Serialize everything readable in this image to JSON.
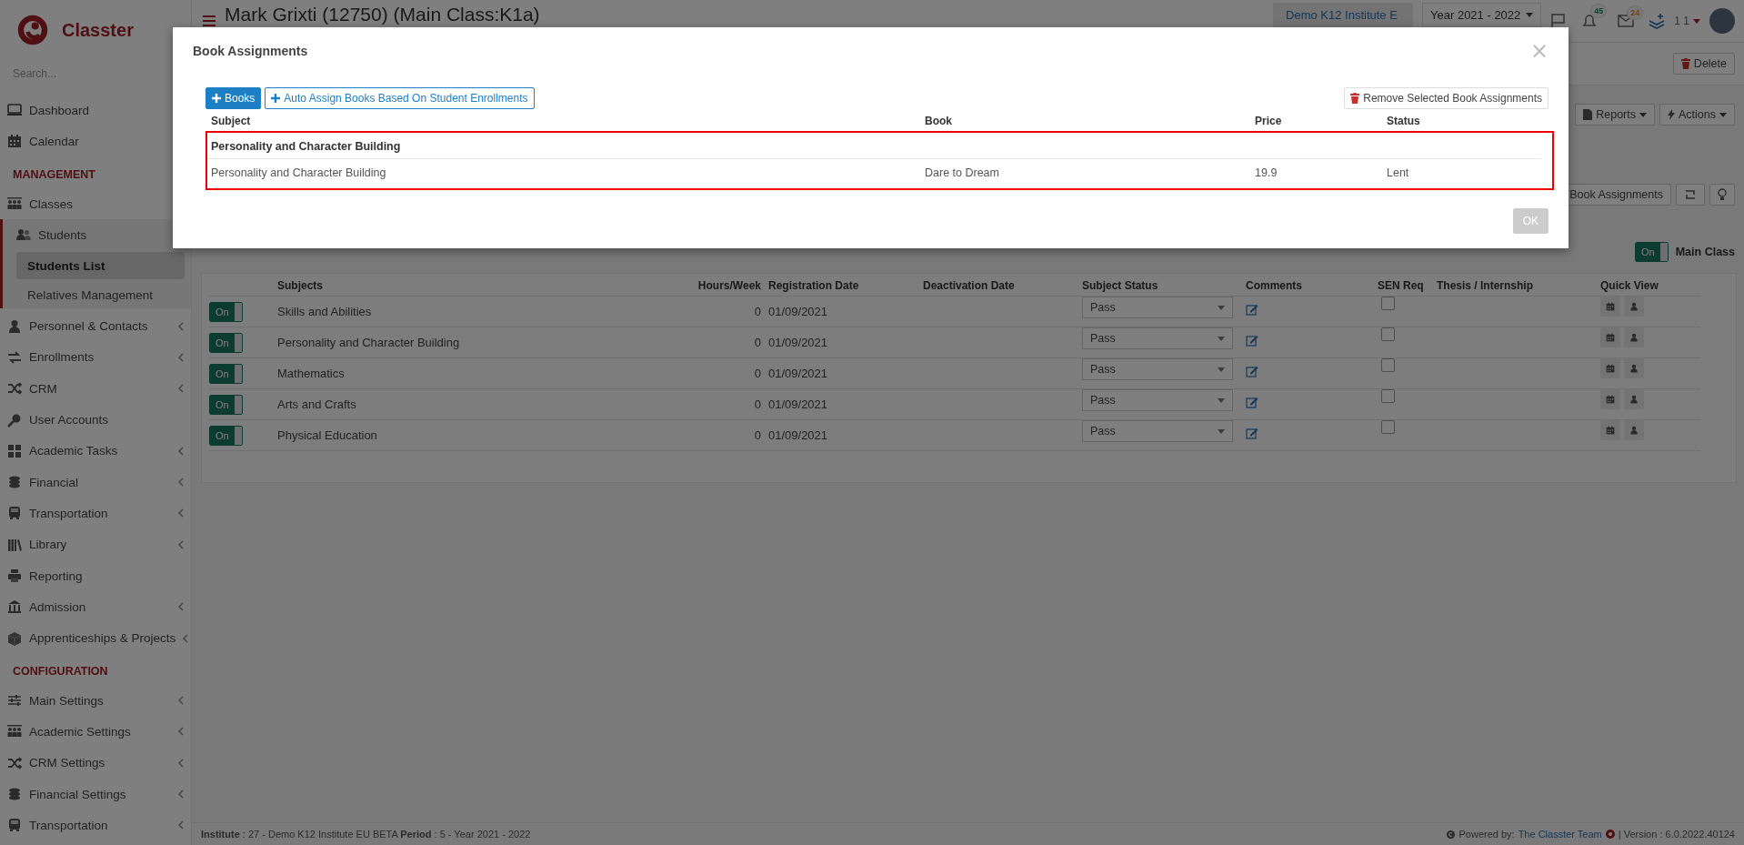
{
  "brand": {
    "name": "Classter"
  },
  "sidebar": {
    "search_placeholder": "Search...",
    "items": [
      {
        "kind": "item",
        "label": "Dashboard",
        "selected": false,
        "submenu": false
      },
      {
        "kind": "item",
        "label": "Calendar",
        "selected": false,
        "submenu": false
      },
      {
        "kind": "heading",
        "label": "MANAGEMENT"
      },
      {
        "kind": "item",
        "label": "Classes",
        "selected": false,
        "submenu": false
      },
      {
        "kind": "item",
        "label": "Students",
        "selected": false,
        "submenu": false,
        "expanded": true,
        "children": [
          {
            "kind": "subitem",
            "label": "Students List",
            "selected": true
          },
          {
            "kind": "subitem",
            "label": "Relatives Management",
            "selected": false
          }
        ]
      },
      {
        "kind": "item",
        "label": "Personnel & Contacts",
        "selected": false,
        "submenu": true
      },
      {
        "kind": "item",
        "label": "Enrollments",
        "selected": false,
        "submenu": true
      },
      {
        "kind": "item",
        "label": "CRM",
        "selected": false,
        "submenu": true
      },
      {
        "kind": "item",
        "label": "User Accounts",
        "selected": false,
        "submenu": false
      },
      {
        "kind": "item",
        "label": "Academic Tasks",
        "selected": false,
        "submenu": true
      },
      {
        "kind": "item",
        "label": "Financial",
        "selected": false,
        "submenu": true
      },
      {
        "kind": "item",
        "label": "Transportation",
        "selected": false,
        "submenu": true
      },
      {
        "kind": "item",
        "label": "Library",
        "selected": false,
        "submenu": true
      },
      {
        "kind": "item",
        "label": "Reporting",
        "selected": false,
        "submenu": false
      },
      {
        "kind": "item",
        "label": "Admission",
        "selected": false,
        "submenu": true
      },
      {
        "kind": "item",
        "label": "Apprenticeships & Projects",
        "selected": false,
        "submenu": true
      },
      {
        "kind": "heading",
        "label": "CONFIGURATION"
      },
      {
        "kind": "item",
        "label": "Main Settings",
        "selected": false,
        "submenu": true
      },
      {
        "kind": "item",
        "label": "Academic Settings",
        "selected": false,
        "submenu": true
      },
      {
        "kind": "item",
        "label": "CRM Settings",
        "selected": false,
        "submenu": true
      },
      {
        "kind": "item",
        "label": "Financial Settings",
        "selected": false,
        "submenu": true
      },
      {
        "kind": "item",
        "label": "Transportation",
        "selected": false,
        "submenu": true
      }
    ]
  },
  "header": {
    "title": "Mark Grixti (12750) (Main Class:K1a)",
    "institute": "Demo K12 Institute E",
    "year": "Year 2021 - 2022",
    "notifications": "45",
    "messages": "24",
    "user": "1 1"
  },
  "toolbar": {
    "delete": "Delete",
    "reports": "Reports",
    "actions": "Actions",
    "book_assignments": "Book Assignments",
    "main_class_toggle": {
      "label": "On",
      "on": true
    },
    "main_class_label": "Main Class"
  },
  "table": {
    "columns": [
      "Subjects",
      "Hours/Week",
      "Registration Date",
      "Deactivation Date",
      "Subject Status",
      "Comments",
      "SEN Req",
      "Thesis / Internship",
      "Quick View"
    ],
    "rows": [
      {
        "toggle_label": "On",
        "on": true,
        "subject": "Skills and Abilities",
        "hours": "0",
        "registration": "01/09/2021",
        "status": "Pass",
        "sen_req": false
      },
      {
        "toggle_label": "On",
        "on": true,
        "subject": "Personality and Character Building",
        "hours": "0",
        "registration": "01/09/2021",
        "status": "Pass",
        "sen_req": false
      },
      {
        "toggle_label": "On",
        "on": true,
        "subject": "Mathematics",
        "hours": "0",
        "registration": "01/09/2021",
        "status": "Pass",
        "sen_req": false
      },
      {
        "toggle_label": "On",
        "on": true,
        "subject": "Arts and Crafts",
        "hours": "0",
        "registration": "01/09/2021",
        "status": "Pass",
        "sen_req": false
      },
      {
        "toggle_label": "On",
        "on": true,
        "subject": "Physical Education",
        "hours": "0",
        "registration": "01/09/2021",
        "status": "Pass",
        "sen_req": false
      }
    ]
  },
  "footer": {
    "info": "**Institute** : 27 - Demo K12 Institute EU BETA **Period** : 5 - Year 2021 - 2022",
    "powered_by": "Powered by:",
    "team_link": "The Classter Team",
    "version": "| Version : 6.0.2022.40124"
  },
  "modal": {
    "title": "Book Assignments",
    "close": "×",
    "add_books": "Books",
    "auto_assign": "Auto Assign Books Based On Student Enrollments",
    "remove": "Remove Selected Book Assignments",
    "columns": [
      "Subject",
      "Book",
      "Price",
      "Status"
    ],
    "groups": [
      {
        "title": "Personality and Character Building",
        "highlighted": true,
        "rows": [
          {
            "subject": "Personality and Character Building",
            "book": "Dare to Dream",
            "price": "19.9",
            "status": "Lent"
          }
        ]
      }
    ],
    "ok_button": {
      "label": "OK",
      "disabled": true
    }
  }
}
